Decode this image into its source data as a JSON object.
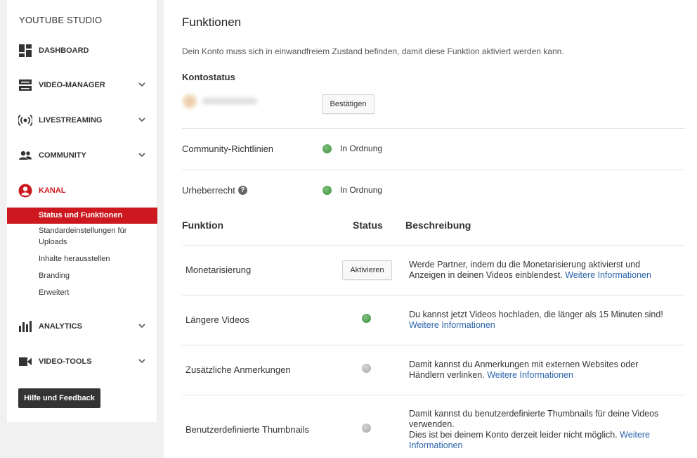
{
  "sidebar": {
    "brand": "YOUTUBE STUDIO",
    "items": [
      {
        "label": "DASHBOARD",
        "icon": "dashboard-icon"
      },
      {
        "label": "VIDEO-MANAGER",
        "icon": "video-manager-icon"
      },
      {
        "label": "LIVESTREAMING",
        "icon": "livestream-icon"
      },
      {
        "label": "COMMUNITY",
        "icon": "community-icon"
      },
      {
        "label": "KANAL",
        "icon": "channel-icon"
      },
      {
        "label": "ANALYTICS",
        "icon": "analytics-icon"
      },
      {
        "label": "VIDEO-TOOLS",
        "icon": "video-tools-icon"
      }
    ],
    "kanal_sub": [
      "Status und Funktionen",
      "Standardeinstellungen für Uploads",
      "Inhalte herausstellen",
      "Branding",
      "Erweitert"
    ],
    "help_label": "Hilfe und Feedback"
  },
  "main": {
    "title": "Funktionen",
    "intro": "Dein Konto muss sich in einwandfreiem Zustand befinden, damit diese Funktion aktiviert werden kann.",
    "konto_heading": "Kontostatus",
    "confirm_label": "Bestätigen",
    "community_label": "Community-Richtlinien",
    "community_status": "In Ordnung",
    "copyright_label": "Urheberrecht",
    "copyright_status": "In Ordnung",
    "table": {
      "headers": {
        "function": "Funktion",
        "status": "Status",
        "description": "Beschreibung"
      },
      "rows": [
        {
          "name": "Monetarisierung",
          "button": "Aktivieren",
          "desc": "Werde Partner, indem du die Monetarisierung aktivierst und Anzeigen in deinen Videos einblendest.",
          "link": "Weitere Informationen"
        },
        {
          "name": "Längere Videos",
          "status": "green",
          "desc": "Du kannst jetzt Videos hochladen, die länger als 15 Minuten sind!",
          "link": "Weitere Informationen"
        },
        {
          "name": "Zusätzliche Anmerkungen",
          "status": "grey",
          "desc": "Damit kannst du Anmerkungen mit externen Websites oder Händlern verlinken.",
          "link": "Weitere Informationen"
        },
        {
          "name": "Benutzerdefinierte Thumbnails",
          "status": "grey",
          "desc": "Damit kannst du benutzerdefinierte Thumbnails für deine Videos verwenden.",
          "desc2": "Dies ist bei deinem Konto derzeit leider nicht möglich.",
          "link": "Weitere Informationen"
        }
      ]
    }
  },
  "colors": {
    "accent": "#cc181e",
    "link": "#2b64a8",
    "ok": "#3c8f3c",
    "inactive": "#a8a8a8"
  }
}
